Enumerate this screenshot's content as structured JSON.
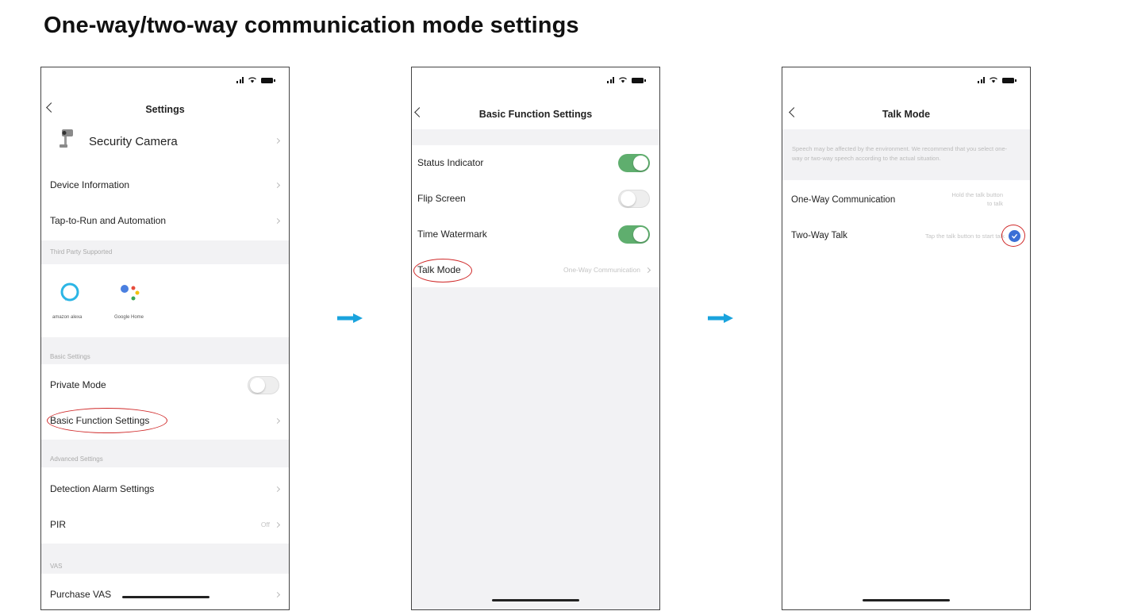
{
  "title": "One-way/two-way communication mode settings",
  "phone1": {
    "nav_title": "Settings",
    "device_name": "Security Camera",
    "rows": {
      "device_info": "Device Information",
      "tap_to_run": "Tap-to-Run and Automation"
    },
    "third_party_label": "Third Party Supported",
    "third_party": {
      "alexa": "amazon alexa",
      "google": "Google Home"
    },
    "basic_settings_label": "Basic Settings",
    "private_mode": "Private Mode",
    "basic_function": "Basic Function Settings",
    "advanced_label": "Advanced Settings",
    "detection_alarm": "Detection Alarm Settings",
    "pir": "PIR",
    "pir_value": "Off",
    "vas_label": "VAS",
    "purchase_vas": "Purchase VAS"
  },
  "phone2": {
    "nav_title": "Basic Function Settings",
    "status_indicator": "Status Indicator",
    "flip_screen": "Flip Screen",
    "time_watermark": "Time Watermark",
    "talk_mode": "Talk Mode",
    "talk_mode_value": "One-Way Communication"
  },
  "phone3": {
    "nav_title": "Talk Mode",
    "hint": "Speech may be affected by the environment. We recommend that you select one-way or two-way speech according to the actual situation.",
    "one_way": "One-Way Communication",
    "one_way_desc_1": "Hold the talk button",
    "one_way_desc_2": "to talk",
    "two_way": "Two-Way Talk",
    "two_way_desc": "Tap the talk button to start talk"
  },
  "colors": {
    "toggle_on": "#5fae6e",
    "arrow": "#1aa3dd",
    "highlight_ring": "#d02a2a",
    "check": "#3a6fd6"
  }
}
